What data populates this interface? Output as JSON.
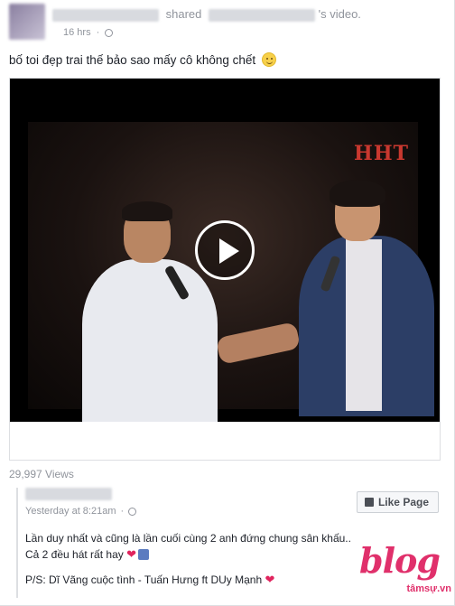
{
  "header": {
    "shared_word": "shared",
    "video_suffix": "'s video.",
    "time": "16 hrs",
    "dot": "·"
  },
  "post": {
    "text": "bố toi đẹp trai thế bảo sao mấy cô không chết",
    "emoji": "smile-emoji"
  },
  "video": {
    "channel_logo": "HHT",
    "play_icon": "play-icon"
  },
  "stats": {
    "views": "29,997 Views"
  },
  "comment": {
    "time": "Yesterday at 8:21am",
    "dot": "·",
    "like_page_label": "Like Page",
    "body": "Lần duy nhất và cũng là lần cuối cùng 2 anh đứng chung sân khấu.. Cả 2 đều hát rất hay",
    "ps": "P/S: Dĩ Vãng cuộc tình - Tuấn Hưng ft DUy Mạnh"
  },
  "watermark": {
    "brand": "blog",
    "site": "tâmsự.vn"
  },
  "colors": {
    "heart": "#e0245e",
    "watermark": "#e0306b",
    "meta_gray": "#90949c"
  }
}
